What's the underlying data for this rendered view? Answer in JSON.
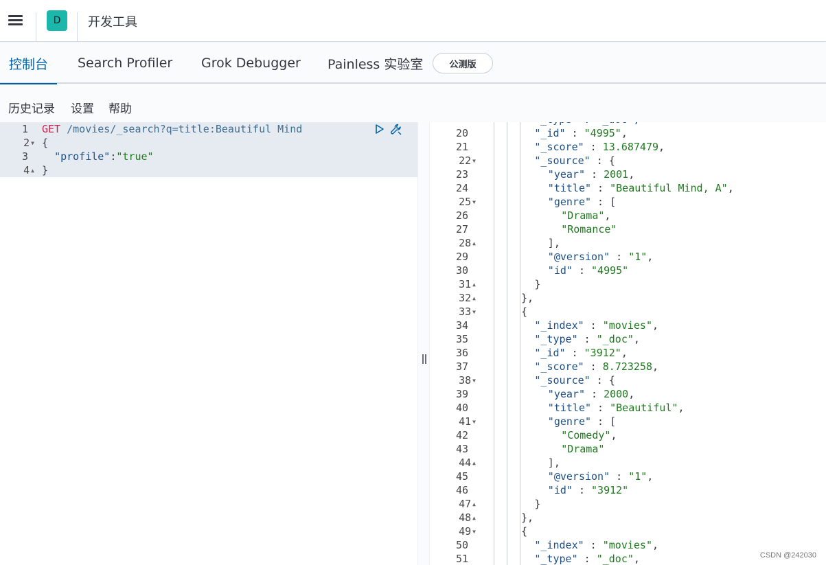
{
  "header": {
    "space_initial": "D",
    "app_title": "开发工具"
  },
  "tabs": [
    {
      "label": "控制台",
      "active": true
    },
    {
      "label": "Search Profiler",
      "active": false
    },
    {
      "label": "Grok Debugger",
      "active": false
    },
    {
      "label": "Painless 实验室",
      "active": false
    }
  ],
  "beta_badge": "公测版",
  "topbar": {
    "history": "历史记录",
    "settings": "设置",
    "help": "帮助"
  },
  "request": {
    "line_numbers": [
      "1",
      "2",
      "3",
      "4"
    ],
    "method": "GET",
    "url": "/movies/_search?q=title:Beautiful Mind",
    "line2": "{",
    "line3_key": "\"profile\"",
    "line3_sep": ":",
    "line3_val": "\"true\"",
    "line4": "}"
  },
  "response": {
    "partial_top": "\"_type\" : \"_doc\",",
    "lines": [
      {
        "n": "20",
        "indent": 4,
        "key": "\"_id\"",
        "val": "\"4995\"",
        "tail": ","
      },
      {
        "n": "21",
        "indent": 4,
        "key": "\"_score\"",
        "val": "13.687479",
        "tail": ","
      },
      {
        "n": "22",
        "indent": 4,
        "key": "\"_source\"",
        "val": "{",
        "tail": "",
        "fold": "down"
      },
      {
        "n": "23",
        "indent": 5,
        "key": "\"year\"",
        "val": "2001",
        "tail": ","
      },
      {
        "n": "24",
        "indent": 5,
        "key": "\"title\"",
        "val": "\"Beautiful Mind, A\"",
        "tail": ","
      },
      {
        "n": "25",
        "indent": 5,
        "key": "\"genre\"",
        "val": "[",
        "tail": "",
        "fold": "down"
      },
      {
        "n": "26",
        "indent": 6,
        "key": "",
        "val": "\"Drama\"",
        "tail": ","
      },
      {
        "n": "27",
        "indent": 6,
        "key": "",
        "val": "\"Romance\"",
        "tail": ""
      },
      {
        "n": "28",
        "indent": 5,
        "key": "",
        "val": "],",
        "tail": "",
        "fold": "up"
      },
      {
        "n": "29",
        "indent": 5,
        "key": "\"@version\"",
        "val": "\"1\"",
        "tail": ","
      },
      {
        "n": "30",
        "indent": 5,
        "key": "\"id\"",
        "val": "\"4995\"",
        "tail": ""
      },
      {
        "n": "31",
        "indent": 4,
        "key": "",
        "val": "}",
        "tail": "",
        "fold": "up"
      },
      {
        "n": "32",
        "indent": 3,
        "key": "",
        "val": "},",
        "tail": "",
        "fold": "up"
      },
      {
        "n": "33",
        "indent": 3,
        "key": "",
        "val": "{",
        "tail": "",
        "fold": "down"
      },
      {
        "n": "34",
        "indent": 4,
        "key": "\"_index\"",
        "val": "\"movies\"",
        "tail": ","
      },
      {
        "n": "35",
        "indent": 4,
        "key": "\"_type\"",
        "val": "\"_doc\"",
        "tail": ","
      },
      {
        "n": "36",
        "indent": 4,
        "key": "\"_id\"",
        "val": "\"3912\"",
        "tail": ","
      },
      {
        "n": "37",
        "indent": 4,
        "key": "\"_score\"",
        "val": "8.723258",
        "tail": ","
      },
      {
        "n": "38",
        "indent": 4,
        "key": "\"_source\"",
        "val": "{",
        "tail": "",
        "fold": "down"
      },
      {
        "n": "39",
        "indent": 5,
        "key": "\"year\"",
        "val": "2000",
        "tail": ","
      },
      {
        "n": "40",
        "indent": 5,
        "key": "\"title\"",
        "val": "\"Beautiful\"",
        "tail": ","
      },
      {
        "n": "41",
        "indent": 5,
        "key": "\"genre\"",
        "val": "[",
        "tail": "",
        "fold": "down"
      },
      {
        "n": "42",
        "indent": 6,
        "key": "",
        "val": "\"Comedy\"",
        "tail": ","
      },
      {
        "n": "43",
        "indent": 6,
        "key": "",
        "val": "\"Drama\"",
        "tail": ""
      },
      {
        "n": "44",
        "indent": 5,
        "key": "",
        "val": "],",
        "tail": "",
        "fold": "up"
      },
      {
        "n": "45",
        "indent": 5,
        "key": "\"@version\"",
        "val": "\"1\"",
        "tail": ","
      },
      {
        "n": "46",
        "indent": 5,
        "key": "\"id\"",
        "val": "\"3912\"",
        "tail": ""
      },
      {
        "n": "47",
        "indent": 4,
        "key": "",
        "val": "}",
        "tail": "",
        "fold": "up"
      },
      {
        "n": "48",
        "indent": 3,
        "key": "",
        "val": "},",
        "tail": "",
        "fold": "up"
      },
      {
        "n": "49",
        "indent": 3,
        "key": "",
        "val": "{",
        "tail": "",
        "fold": "down"
      },
      {
        "n": "50",
        "indent": 4,
        "key": "\"_index\"",
        "val": "\"movies\"",
        "tail": ","
      },
      {
        "n": "51",
        "indent": 4,
        "key": "\"_type\"",
        "val": "\"_doc\"",
        "tail": ","
      }
    ]
  },
  "watermark": "CSDN @242030",
  "colors": {
    "accent": "#0061a6",
    "space_avatar": "#1bb7ab",
    "method": "#c7254e",
    "string": "#1f7a1f",
    "key": "#1c4e88"
  }
}
